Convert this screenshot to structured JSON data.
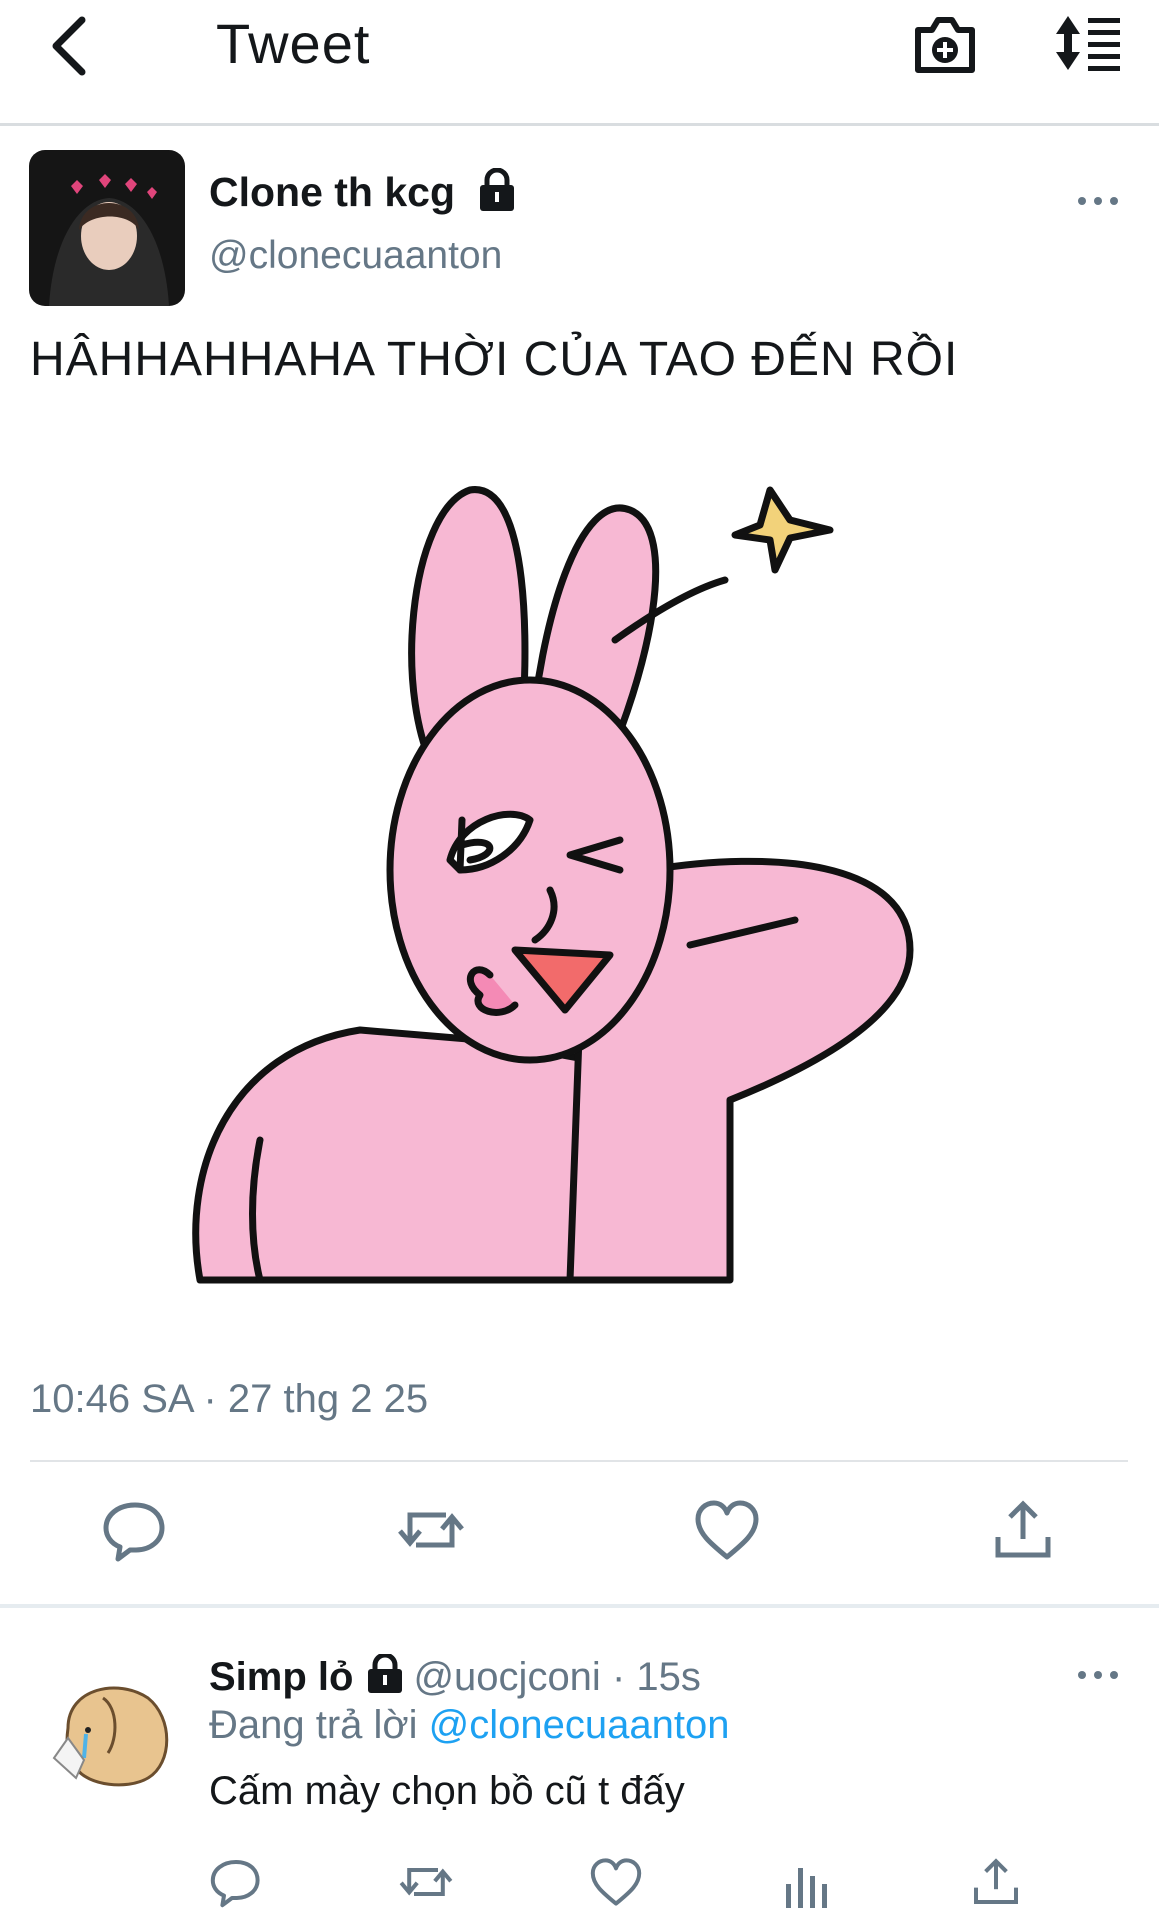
{
  "header": {
    "back_icon": "chevron-left-icon",
    "title": "Tweet",
    "camera_icon": "camera-plus-icon",
    "sort_icon": "sort-timeline-icon"
  },
  "tweet": {
    "display_name": "Clone th kcg",
    "handle": "@clonecuaanton",
    "protected_icon": "lock-icon",
    "more_icon": "more-horizontal-icon",
    "text": "HÂHHAHHAHA THỜI CỦA TAO ĐẾN RỒI",
    "media_description_icon": "pink-bunny-sticker",
    "timestamp": "10:46 SA · 27 thg 2 25",
    "actions": [
      "reply-icon",
      "retweet-icon",
      "like-icon",
      "share-icon"
    ]
  },
  "reply": {
    "display_name": "Simp lỏ",
    "handle": "@uocjconi",
    "separator": "·",
    "time": "15s",
    "replying_prefix": "Đang trả lời",
    "replying_to": "@clonecuaanton",
    "text": "Cấm mày chọn bồ cũ t đấy",
    "actions": [
      "reply-icon",
      "retweet-icon",
      "like-icon",
      "analytics-icon",
      "share-icon"
    ]
  },
  "colors": {
    "text_primary": "#14171a",
    "text_secondary": "#657786",
    "link": "#1da1f2",
    "icon": "#657786",
    "bunny_pink": "#f7b8d3",
    "star_yellow": "#f2d27a"
  }
}
